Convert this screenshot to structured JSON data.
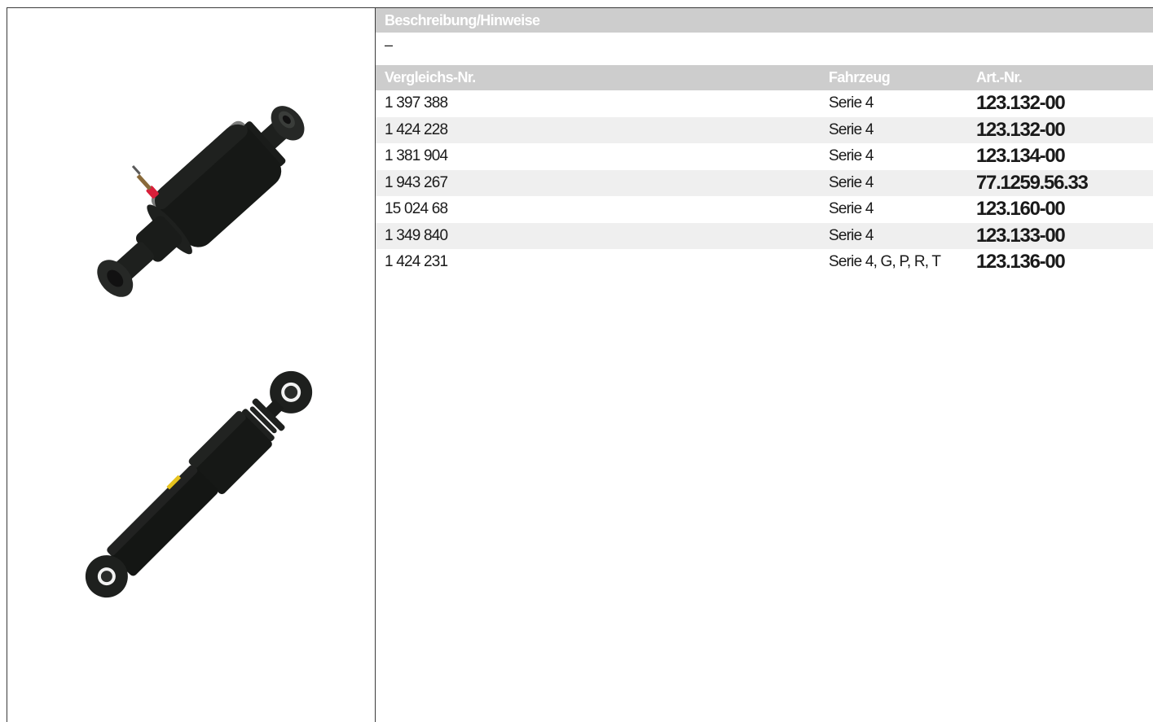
{
  "description": {
    "header": "Beschreibung/Hinweise",
    "value": "–"
  },
  "table": {
    "headers": {
      "comparison_no": "Vergleichs-Nr.",
      "vehicle": "Fahrzeug",
      "article_no": "Art.-Nr."
    },
    "rows": [
      {
        "comparison_no": "1 397 388",
        "vehicle": "Serie 4",
        "article_no": "123.132-00"
      },
      {
        "comparison_no": "1 424 228",
        "vehicle": "Serie 4",
        "article_no": "123.132-00"
      },
      {
        "comparison_no": "1 381 904",
        "vehicle": "Serie 4",
        "article_no": "123.134-00"
      },
      {
        "comparison_no": "1 943 267",
        "vehicle": "Serie 4",
        "article_no": "77.1259.56.33"
      },
      {
        "comparison_no": "15 024 68",
        "vehicle": "Serie 4",
        "article_no": "123.160-00"
      },
      {
        "comparison_no": "1 349 840",
        "vehicle": "Serie 4",
        "article_no": "123.133-00"
      },
      {
        "comparison_no": "1 424 231",
        "vehicle": "Serie 4, G, P, R, T",
        "article_no": "123.136-00"
      }
    ]
  },
  "images": [
    {
      "icon": "air-shock-absorber-icon"
    },
    {
      "icon": "shock-absorber-icon"
    }
  ],
  "colors": {
    "header_bg": "#cdcdcd",
    "alt_row_bg": "#efefef",
    "part_color": "#161816",
    "accent_red": "#d81f3a",
    "accent_yellow": "#e6c21e"
  }
}
